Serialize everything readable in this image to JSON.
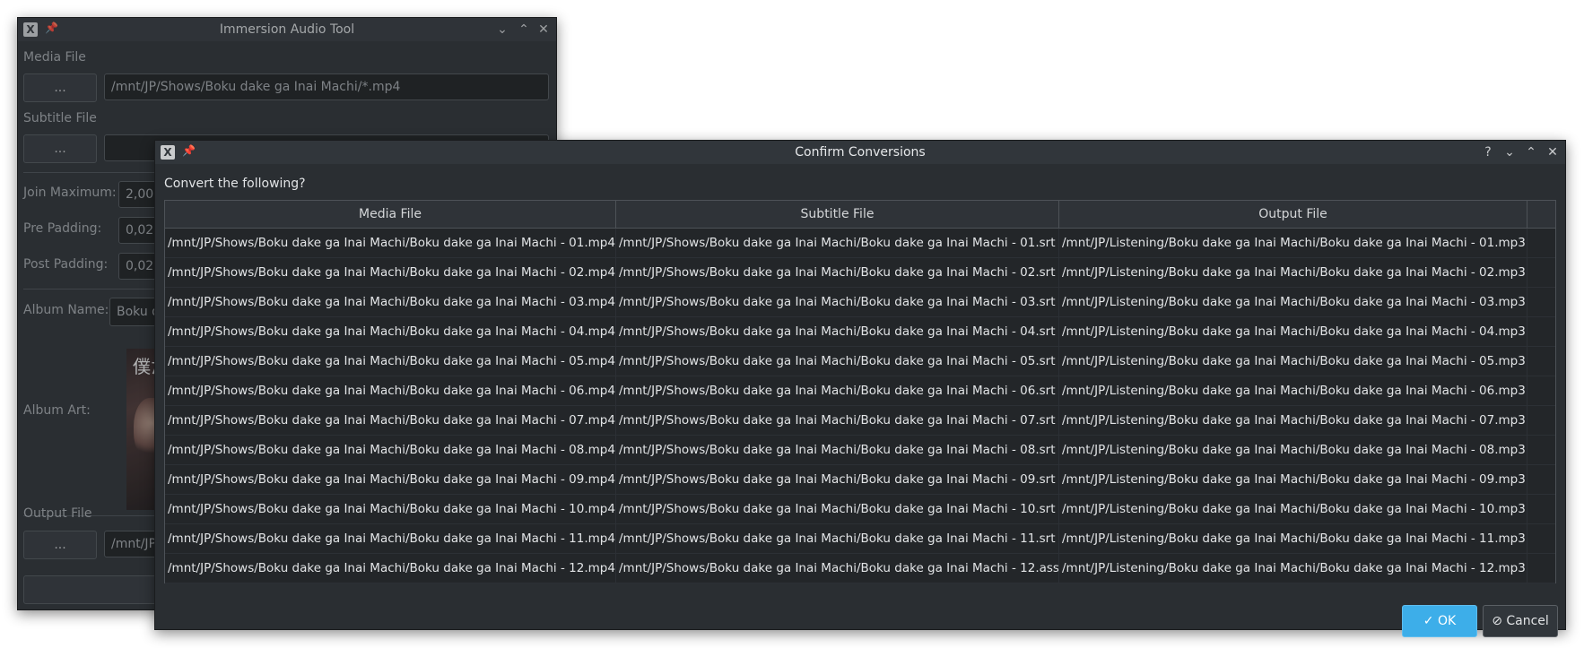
{
  "main_window": {
    "title": "Immersion Audio Tool",
    "media_file_label": "Media File",
    "media_browse_label": "...",
    "media_path": "/mnt/JP/Shows/Boku dake ga Inai Machi/*.mp4",
    "subtitle_file_label": "Subtitle File",
    "subtitle_browse_label": "...",
    "join_maximum_label": "Join Maximum:",
    "join_maximum_value": "2,00",
    "pre_padding_label": "Pre Padding:",
    "pre_padding_value": "0,02",
    "post_padding_label": "Post Padding:",
    "post_padding_value": "0,02",
    "album_name_label": "Album Name:",
    "album_name_value": "Boku d",
    "album_art_label": "Album Art:",
    "album_art_text": "僕だ",
    "output_file_label": "Output File",
    "output_browse_label": "...",
    "output_path": "/mnt/JP"
  },
  "dialog": {
    "title": "Confirm Conversions",
    "prompt": "Convert the following?",
    "columns": [
      "Media File",
      "Subtitle File",
      "Output File"
    ],
    "rows": [
      [
        "/mnt/JP/Shows/Boku dake ga Inai Machi/Boku dake ga Inai Machi - 01.mp4",
        "/mnt/JP/Shows/Boku dake ga Inai Machi/Boku dake ga Inai Machi - 01.srt",
        "/mnt/JP/Listening/Boku dake ga Inai Machi/Boku dake ga Inai Machi - 01.mp3"
      ],
      [
        "/mnt/JP/Shows/Boku dake ga Inai Machi/Boku dake ga Inai Machi - 02.mp4",
        "/mnt/JP/Shows/Boku dake ga Inai Machi/Boku dake ga Inai Machi - 02.srt",
        "/mnt/JP/Listening/Boku dake ga Inai Machi/Boku dake ga Inai Machi - 02.mp3"
      ],
      [
        "/mnt/JP/Shows/Boku dake ga Inai Machi/Boku dake ga Inai Machi - 03.mp4",
        "/mnt/JP/Shows/Boku dake ga Inai Machi/Boku dake ga Inai Machi - 03.srt",
        "/mnt/JP/Listening/Boku dake ga Inai Machi/Boku dake ga Inai Machi - 03.mp3"
      ],
      [
        "/mnt/JP/Shows/Boku dake ga Inai Machi/Boku dake ga Inai Machi - 04.mp4",
        "/mnt/JP/Shows/Boku dake ga Inai Machi/Boku dake ga Inai Machi - 04.srt",
        "/mnt/JP/Listening/Boku dake ga Inai Machi/Boku dake ga Inai Machi - 04.mp3"
      ],
      [
        "/mnt/JP/Shows/Boku dake ga Inai Machi/Boku dake ga Inai Machi - 05.mp4",
        "/mnt/JP/Shows/Boku dake ga Inai Machi/Boku dake ga Inai Machi - 05.srt",
        "/mnt/JP/Listening/Boku dake ga Inai Machi/Boku dake ga Inai Machi - 05.mp3"
      ],
      [
        "/mnt/JP/Shows/Boku dake ga Inai Machi/Boku dake ga Inai Machi - 06.mp4",
        "/mnt/JP/Shows/Boku dake ga Inai Machi/Boku dake ga Inai Machi - 06.srt",
        "/mnt/JP/Listening/Boku dake ga Inai Machi/Boku dake ga Inai Machi - 06.mp3"
      ],
      [
        "/mnt/JP/Shows/Boku dake ga Inai Machi/Boku dake ga Inai Machi - 07.mp4",
        "/mnt/JP/Shows/Boku dake ga Inai Machi/Boku dake ga Inai Machi - 07.srt",
        "/mnt/JP/Listening/Boku dake ga Inai Machi/Boku dake ga Inai Machi - 07.mp3"
      ],
      [
        "/mnt/JP/Shows/Boku dake ga Inai Machi/Boku dake ga Inai Machi - 08.mp4",
        "/mnt/JP/Shows/Boku dake ga Inai Machi/Boku dake ga Inai Machi - 08.srt",
        "/mnt/JP/Listening/Boku dake ga Inai Machi/Boku dake ga Inai Machi - 08.mp3"
      ],
      [
        "/mnt/JP/Shows/Boku dake ga Inai Machi/Boku dake ga Inai Machi - 09.mp4",
        "/mnt/JP/Shows/Boku dake ga Inai Machi/Boku dake ga Inai Machi - 09.srt",
        "/mnt/JP/Listening/Boku dake ga Inai Machi/Boku dake ga Inai Machi - 09.mp3"
      ],
      [
        "/mnt/JP/Shows/Boku dake ga Inai Machi/Boku dake ga Inai Machi - 10.mp4",
        "/mnt/JP/Shows/Boku dake ga Inai Machi/Boku dake ga Inai Machi - 10.srt",
        "/mnt/JP/Listening/Boku dake ga Inai Machi/Boku dake ga Inai Machi - 10.mp3"
      ],
      [
        "/mnt/JP/Shows/Boku dake ga Inai Machi/Boku dake ga Inai Machi - 11.mp4",
        "/mnt/JP/Shows/Boku dake ga Inai Machi/Boku dake ga Inai Machi - 11.srt",
        "/mnt/JP/Listening/Boku dake ga Inai Machi/Boku dake ga Inai Machi - 11.mp3"
      ],
      [
        "/mnt/JP/Shows/Boku dake ga Inai Machi/Boku dake ga Inai Machi - 12.mp4",
        "/mnt/JP/Shows/Boku dake ga Inai Machi/Boku dake ga Inai Machi - 12.ass",
        "/mnt/JP/Listening/Boku dake ga Inai Machi/Boku dake ga Inai Machi - 12.mp3"
      ]
    ],
    "ok_label": "OK",
    "cancel_label": "Cancel",
    "help_glyph": "?"
  }
}
